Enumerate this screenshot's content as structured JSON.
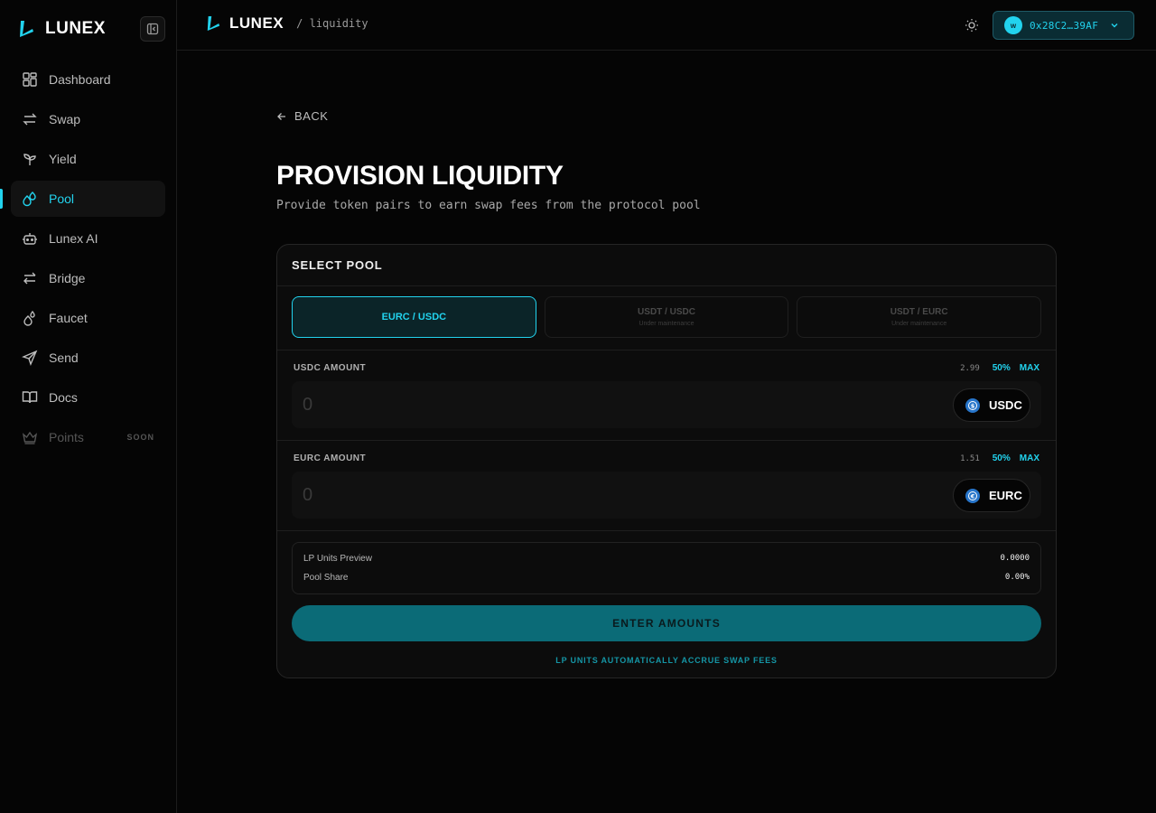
{
  "app": {
    "name": "LUNEX",
    "breadcrumb": "/ liquidity"
  },
  "colors": {
    "accent": "#22d3ee",
    "cta": "#0b6b77",
    "background": "#050505"
  },
  "sidebar": {
    "items": [
      {
        "label": "Dashboard",
        "icon": "dashboard-icon"
      },
      {
        "label": "Swap",
        "icon": "swap-icon"
      },
      {
        "label": "Yield",
        "icon": "sprout-icon"
      },
      {
        "label": "Pool",
        "icon": "droplets-icon",
        "active": true
      },
      {
        "label": "Lunex AI",
        "icon": "bot-icon"
      },
      {
        "label": "Bridge",
        "icon": "bridge-icon"
      },
      {
        "label": "Faucet",
        "icon": "faucet-icon"
      },
      {
        "label": "Send",
        "icon": "send-icon"
      },
      {
        "label": "Docs",
        "icon": "book-icon"
      },
      {
        "label": "Points",
        "icon": "crown-icon",
        "disabled": true,
        "badge": "SOON"
      }
    ]
  },
  "header": {
    "wallet_address": "0x28C2…39AF"
  },
  "page": {
    "back_label": "BACK",
    "title": "PROVISION LIQUIDITY",
    "subtitle": "Provide token pairs to earn swap fees from the protocol pool"
  },
  "card": {
    "title": "SELECT POOL",
    "pools": [
      {
        "name": "EURC / USDC",
        "status": "",
        "active": true
      },
      {
        "name": "USDT / USDC",
        "status": "Under maintenance",
        "active": false
      },
      {
        "name": "USDT / EURC",
        "status": "Under maintenance",
        "active": false
      }
    ],
    "usdc": {
      "label": "USDC AMOUNT",
      "balance": "2.99",
      "half": "50%",
      "max": "MAX",
      "placeholder": "0",
      "token": "USDC"
    },
    "eurc": {
      "label": "EURC AMOUNT",
      "balance": "1.51",
      "half": "50%",
      "max": "MAX",
      "placeholder": "0",
      "token": "EURC"
    },
    "preview": {
      "lp_label": "LP Units Preview",
      "lp_value": "0.0000",
      "share_label": "Pool Share",
      "share_value": "0.00%"
    },
    "cta_label": "ENTER AMOUNTS",
    "footnote": "LP UNITS AUTOMATICALLY ACCRUE SWAP FEES"
  }
}
